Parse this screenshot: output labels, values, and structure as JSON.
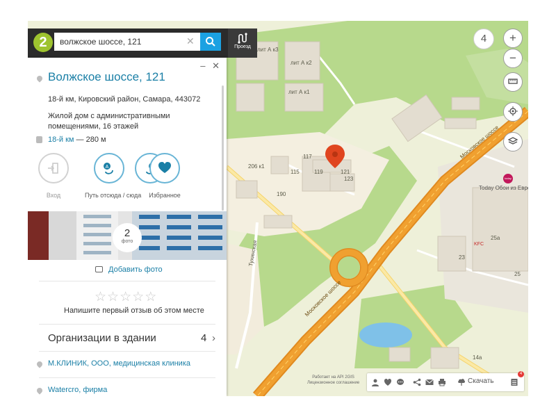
{
  "search": {
    "value": "волжское шоссе, 121",
    "route_label": "Проезд"
  },
  "logo_text": "2",
  "card": {
    "title": "Волжское шоссе, 121",
    "address": "18-й км, Кировский район, Самара, 443072",
    "description": "Жилой дом с административными помещениями, 16 этажей",
    "stop_name": "18-й км",
    "stop_distance": " — 280 м",
    "actions": [
      {
        "label": "Вход"
      },
      {
        "label": "Путь отсюда / сюда"
      },
      {
        "label": "Избранное"
      }
    ],
    "photo_count": "2",
    "photo_caption": "фото",
    "add_photo": "Добавить фото",
    "review_prompt": "Напишите первый отзыв об этом месте",
    "orgs_title": "Организации в здании",
    "orgs_count": "4",
    "orgs": [
      "М.КЛИНИК, ООО, медицинская клиника",
      "Watercro, фирма"
    ]
  },
  "map": {
    "zoom_level": "4",
    "street_labels": [
      "Московское шоссе",
      "Московское шоссе",
      "Тухинская"
    ],
    "building_labels": [
      "лит А к3",
      "лит А к2",
      "лит А к1",
      "117",
      "119",
      "121",
      "123",
      "115",
      "206 к1",
      "190",
      "25а",
      "23",
      "25",
      "14а"
    ],
    "poi": [
      {
        "name": "Today Обои из Европы"
      },
      {
        "name": "KFC"
      }
    ],
    "today_badge": "today",
    "colors": {
      "background": "#eef0d9",
      "park": "#b7d98c",
      "road_main": "#f0a030",
      "water": "#7fc1e8",
      "building": "#e3ddd0",
      "pin": "#e0451f"
    }
  },
  "bottom": {
    "download_label": "Скачать",
    "notif_count": "4",
    "api_line1": "Работает на API 2GIS",
    "api_line2": "Лицензионное соглашение"
  }
}
